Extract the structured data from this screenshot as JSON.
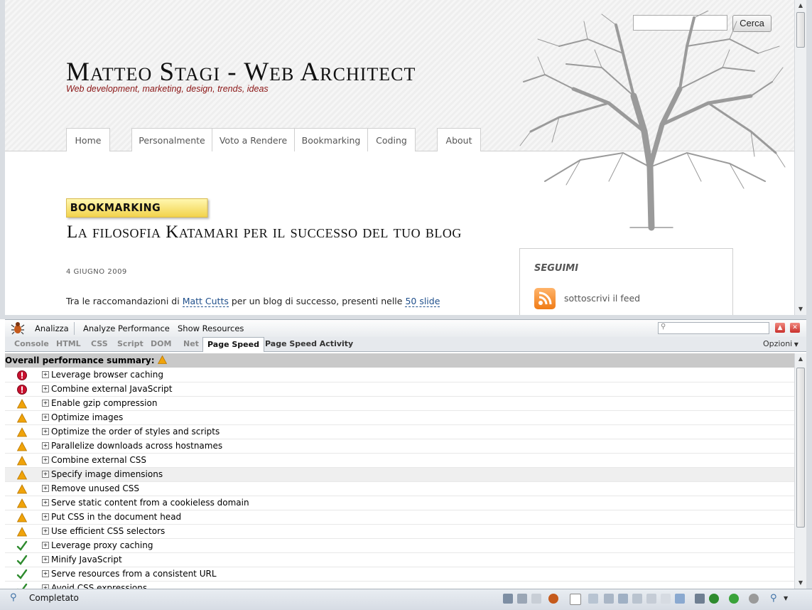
{
  "site": {
    "search_button": "Cerca",
    "title": "Matteo Stagi - Web Architect",
    "tagline": "Web development, marketing, design, trends, ideas",
    "nav": [
      "Home",
      "Personalmente",
      "Voto a Rendere",
      "Bookmarking",
      "Coding",
      "About"
    ],
    "post": {
      "category": "BOOKMARKING",
      "title": "La filosofia Katamari per il successo del tuo blog",
      "date": "4 GIUGNO 2009",
      "text_before": "Tra le raccomandazioni di ",
      "link1": "Matt Cutts",
      "text_middle": " per un blog di successo, presenti nelle ",
      "link2": "50 slide"
    },
    "sidebar": {
      "title": "SEGUIMI",
      "feed_label": "sottoscrivi il feed"
    }
  },
  "firebug": {
    "toolbar": {
      "analyze": "Analizza",
      "analyze_performance": "Analyze Performance",
      "show_resources": "Show Resources"
    },
    "tabs": [
      "Console",
      "HTML",
      "CSS",
      "Script",
      "DOM",
      "Net",
      "Page Speed",
      "Page Speed Activity"
    ],
    "active_tab": "Page Speed",
    "options": "Opzioni",
    "summary": "Overall performance summary:",
    "rules": [
      {
        "label": "Leverage browser caching",
        "status": "error"
      },
      {
        "label": "Combine external JavaScript",
        "status": "error"
      },
      {
        "label": "Enable gzip compression",
        "status": "warning"
      },
      {
        "label": "Optimize images",
        "status": "warning"
      },
      {
        "label": "Optimize the order of styles and scripts",
        "status": "warning"
      },
      {
        "label": "Parallelize downloads across hostnames",
        "status": "warning"
      },
      {
        "label": "Combine external CSS",
        "status": "warning"
      },
      {
        "label": "Specify image dimensions",
        "status": "warning"
      },
      {
        "label": "Remove unused CSS",
        "status": "warning"
      },
      {
        "label": "Serve static content from a cookieless domain",
        "status": "warning"
      },
      {
        "label": "Put CSS in the document head",
        "status": "warning"
      },
      {
        "label": "Use efficient CSS selectors",
        "status": "warning"
      },
      {
        "label": "Leverage proxy caching",
        "status": "pass"
      },
      {
        "label": "Minify JavaScript",
        "status": "pass"
      },
      {
        "label": "Serve resources from a consistent URL",
        "status": "pass"
      },
      {
        "label": "Avoid CSS expressions",
        "status": "pass"
      }
    ]
  },
  "statusbar": {
    "text": "Completato"
  },
  "colors": {
    "tagline": "#8b1515",
    "link": "#1f4f8b",
    "error": "#c8102e",
    "warning": "#f0a30a",
    "pass": "#2e8b2e"
  }
}
